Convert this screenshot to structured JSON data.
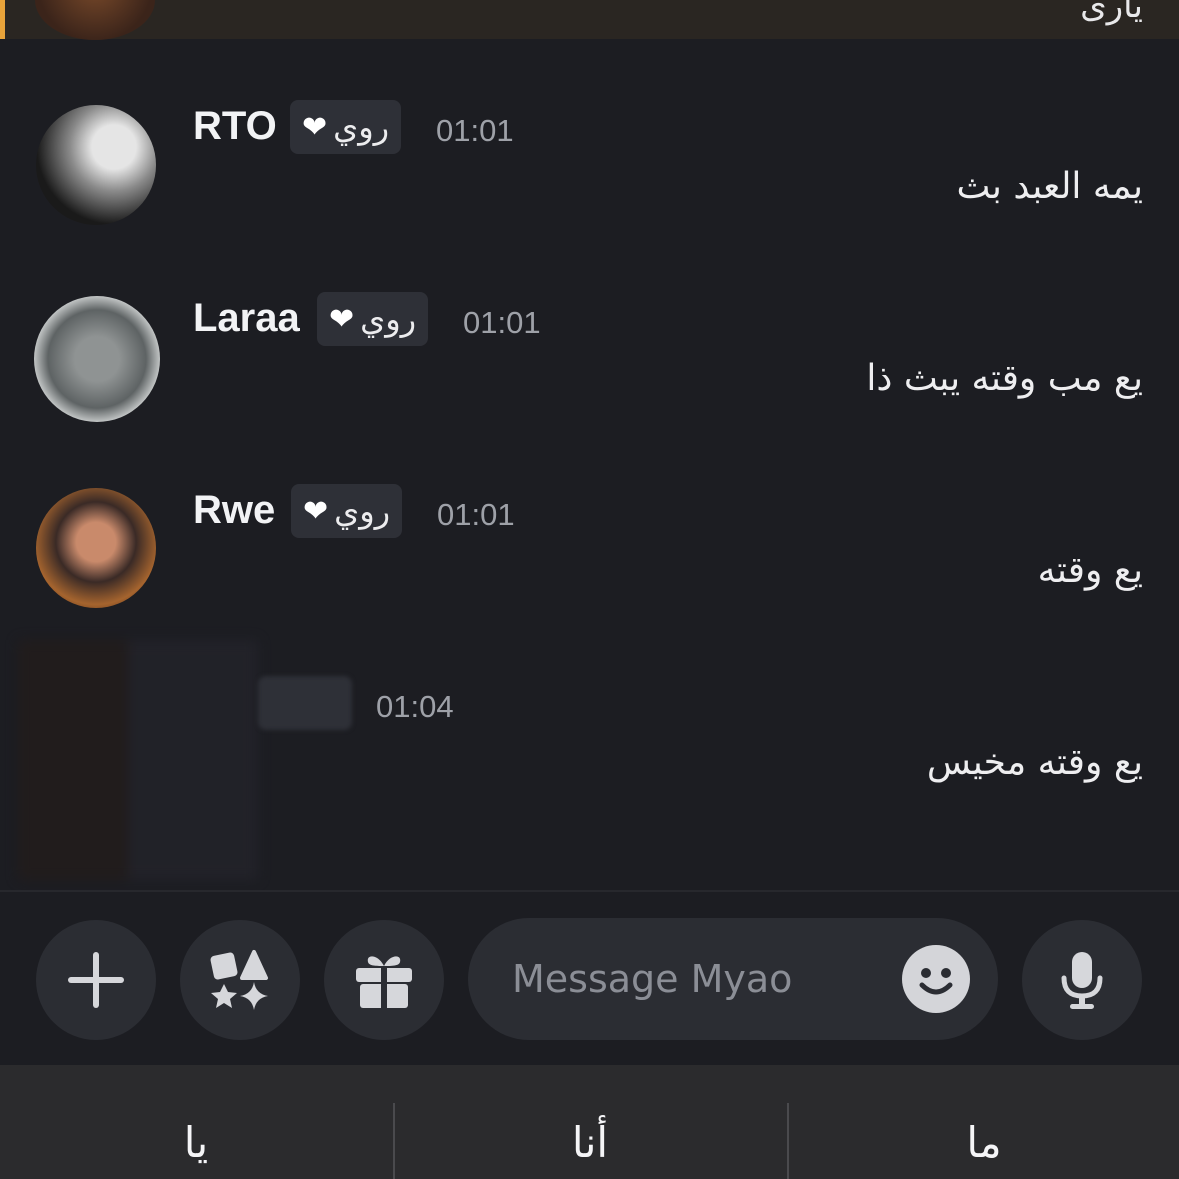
{
  "top_message": {
    "text_partial": "يارى"
  },
  "messages": [
    {
      "author": "RTO",
      "tag_label": "روي",
      "tag_icon": "heart",
      "time": "01:01",
      "text": "يمه العبد بث"
    },
    {
      "author": "Laraa",
      "tag_label": "روي",
      "tag_icon": "heart",
      "time": "01:01",
      "text": "يع مب وقته يبث ذا"
    },
    {
      "author": "Rwe",
      "tag_label": "روي",
      "tag_icon": "heart",
      "time": "01:01",
      "text": "يع وقته"
    },
    {
      "author": "",
      "tag_label": "",
      "time": "01:04",
      "text": "يع وقته مخيس"
    }
  ],
  "composer": {
    "placeholder": "Message Myao",
    "buttons": [
      "plus-icon",
      "apps-icon",
      "gift-icon",
      "emoji-icon",
      "microphone-icon"
    ]
  },
  "keyboard": {
    "suggestions": [
      "يا",
      "أنا",
      "ما"
    ]
  },
  "colors": {
    "background": "#1c1d22",
    "accent": "#e8a33a",
    "button": "#2b2d33",
    "timestamp": "#9ea1a8"
  }
}
